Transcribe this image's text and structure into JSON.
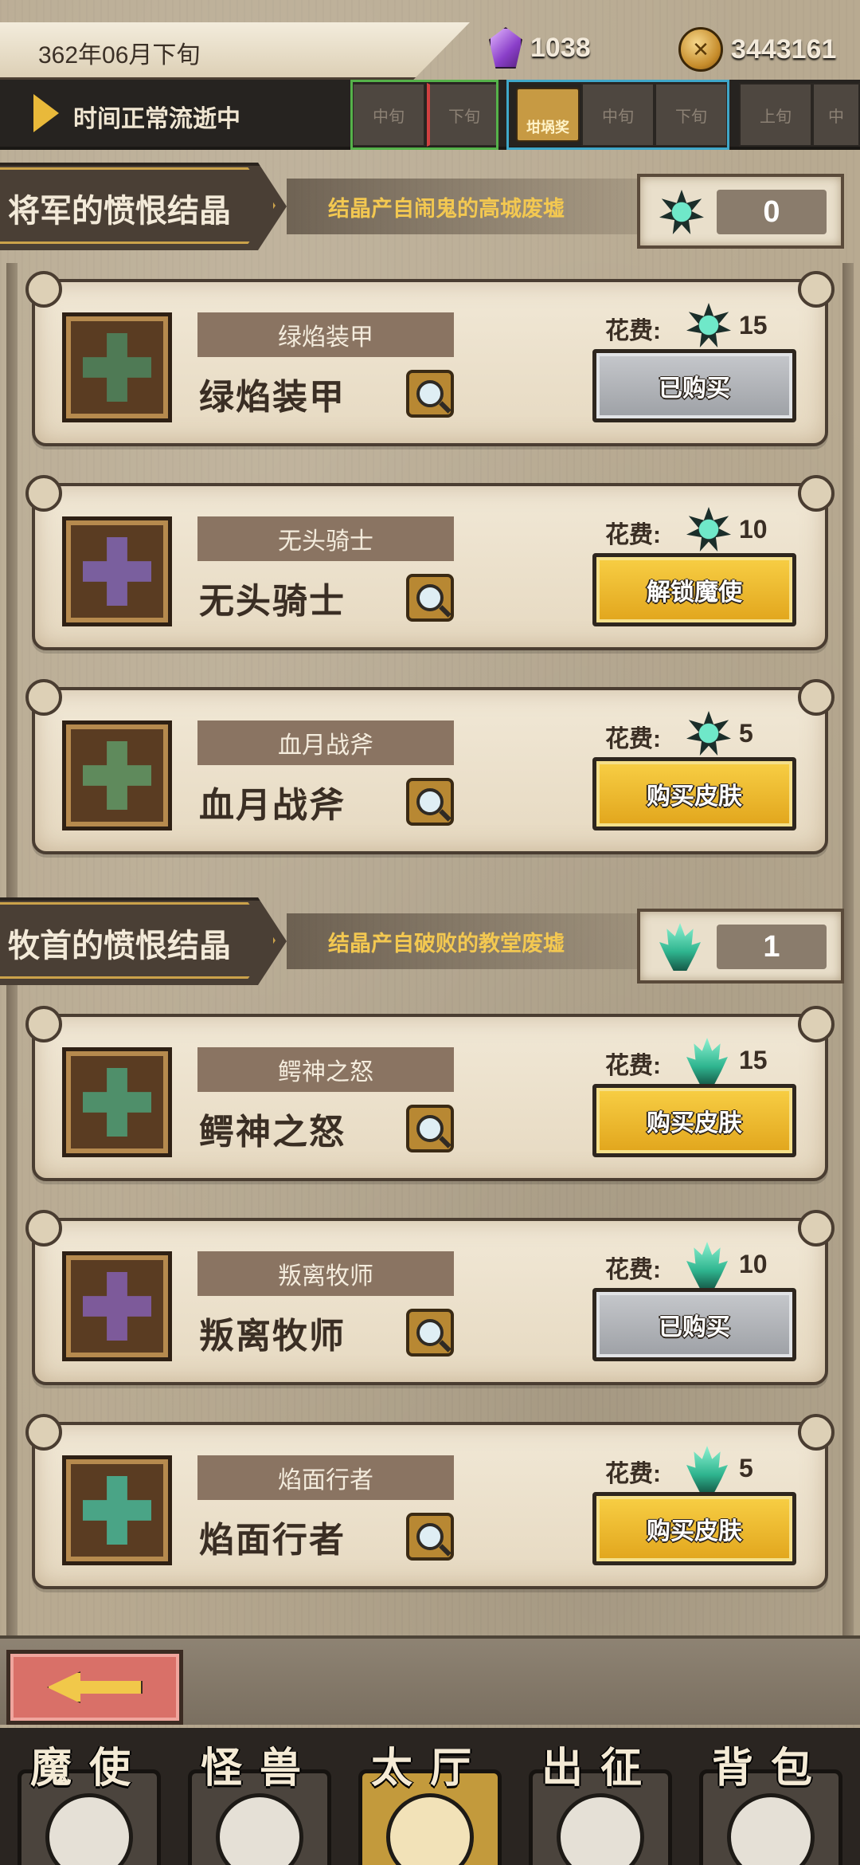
{
  "header": {
    "date": "362年06月下旬",
    "crystals": "1038",
    "gold": "3443161"
  },
  "timeline": {
    "status": "时间正常流逝中",
    "cells": [
      "中旬",
      "下旬",
      "坩埚奖",
      "中旬",
      "下旬",
      "上旬",
      "中"
    ]
  },
  "sections": [
    {
      "title": "将军的愤恨结晶",
      "source": "结晶产自闹鬼的高城废墟",
      "count": "0",
      "gem_icon": "spiked-crystal-icon",
      "items": [
        {
          "plate": "绿焰装甲",
          "name": "绿焰装甲",
          "cost_label": "花费:",
          "cost": "15",
          "action": "已购买",
          "state": "owned",
          "emblem": "#4f7a55"
        },
        {
          "plate": "无头骑士",
          "name": "无头骑士",
          "cost_label": "花费:",
          "cost": "10",
          "action": "解锁魔使",
          "state": "buy",
          "emblem": "#7a5f9e"
        },
        {
          "plate": "血月战斧",
          "name": "血月战斧",
          "cost_label": "花费:",
          "cost": "5",
          "action": "购买皮肤",
          "state": "buy",
          "emblem": "#5f8a5c"
        }
      ]
    },
    {
      "title": "牧首的愤恨结晶",
      "source": "结晶产自破败的教堂废墟",
      "count": "1",
      "gem_icon": "flame-crystal-icon",
      "items": [
        {
          "plate": "鳄神之怒",
          "name": "鳄神之怒",
          "cost_label": "花费:",
          "cost": "15",
          "action": "购买皮肤",
          "state": "buy",
          "emblem": "#4f8f6a"
        },
        {
          "plate": "叛离牧师",
          "name": "叛离牧师",
          "cost_label": "花费:",
          "cost": "10",
          "action": "已购买",
          "state": "owned",
          "emblem": "#7d5a9a"
        },
        {
          "plate": "焰面行者",
          "name": "焰面行者",
          "cost_label": "花费:",
          "cost": "5",
          "action": "购买皮肤",
          "state": "buy",
          "emblem": "#4aa486"
        }
      ]
    }
  ],
  "nav": [
    "魔使",
    "怪兽",
    "太厅",
    "出征",
    "背包"
  ],
  "colors": {
    "buy": "#f1be31",
    "owned": "#b4b6ba",
    "accent": "#f3c851"
  }
}
